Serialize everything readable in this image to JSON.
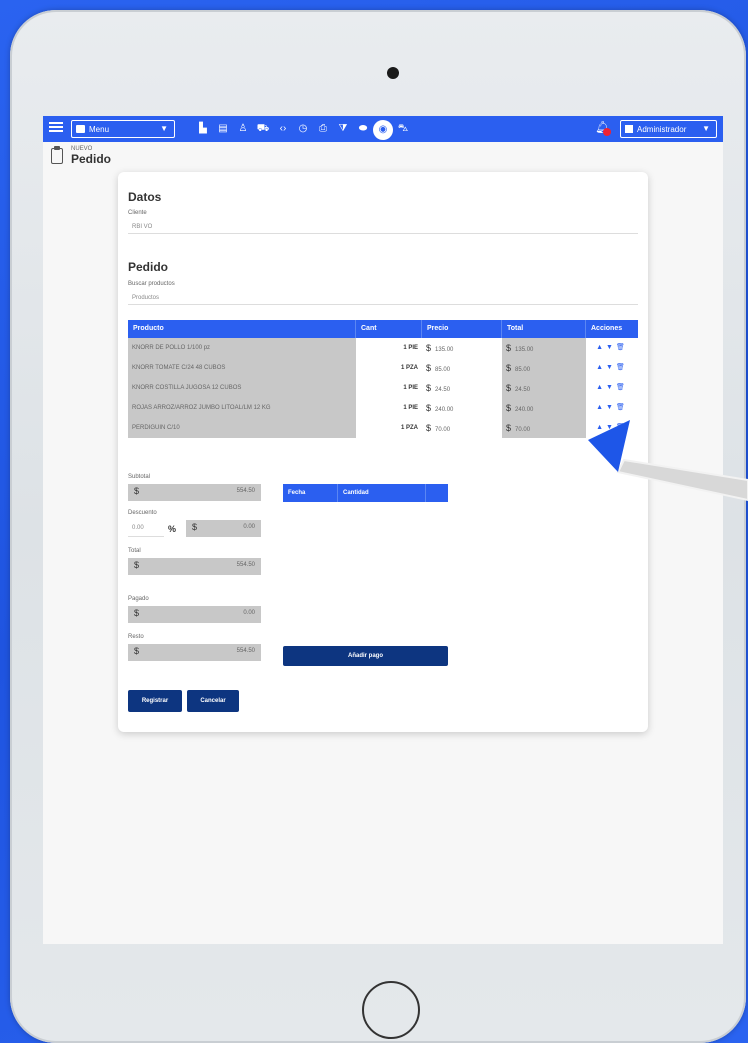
{
  "topbar": {
    "menu_label": "Menu",
    "user_label": "Administrador",
    "nav_icons": [
      "chart-icon",
      "grid-icon",
      "user-icon",
      "truck-icon",
      "code-icon",
      "clock-icon",
      "printer-icon",
      "filter-icon",
      "box-icon",
      "order-icon",
      "cart-icon"
    ]
  },
  "page": {
    "subtitle": "NUEVO",
    "title": "Pedido"
  },
  "datos": {
    "title": "Datos",
    "cliente_label": "Cliente",
    "cliente_value": "RBI VO"
  },
  "pedido": {
    "title": "Pedido",
    "buscar_label": "Buscar productos",
    "buscar_placeholder": "Productos"
  },
  "table": {
    "headers": [
      "Producto",
      "Cant",
      "Precio",
      "Total",
      "Acciones"
    ],
    "rows": [
      {
        "producto": "KNORR DE POLLO 1/100 pz",
        "cant": "1 PIE",
        "precio": "135.00",
        "total": "135.00"
      },
      {
        "producto": "KNORR TOMATE C/24 48 CUBOS",
        "cant": "1 PZA",
        "precio": "85.00",
        "total": "85.00"
      },
      {
        "producto": "KNORR COSTILLA JUGOSA 12 CUBOS",
        "cant": "1 PIE",
        "precio": "24.50",
        "total": "24.50"
      },
      {
        "producto": "ROJAS ARROZ/ARROZ JUMBO LITOAL/LM 12 KG",
        "cant": "1 PIE",
        "precio": "240.00",
        "total": "240.00"
      },
      {
        "producto": "PERDIGUIN C/10",
        "cant": "1 PZA",
        "precio": "70.00",
        "total": "70.00"
      }
    ]
  },
  "summary": {
    "subtotal_label": "Subtotal",
    "subtotal_value": "554.50",
    "descuento_label": "Descuento",
    "descuento_pct": "0.00",
    "pct_symbol": "%",
    "descuento_value": "0.00",
    "total_label": "Total",
    "total_value": "554.50",
    "pagado_label": "Pagado",
    "pagado_value": "0.00",
    "resto_label": "Resto",
    "resto_value": "554.50",
    "currency": "$"
  },
  "payments": {
    "headers": [
      "Fecha",
      "Cantidad",
      ""
    ],
    "add_button": "Añadir pago"
  },
  "buttons": {
    "registrar": "Registrar",
    "cancelar": "Cancelar"
  },
  "colors": {
    "accent": "#2b5ff0",
    "dark_button": "#0d3580",
    "background": "#1f54e0"
  }
}
